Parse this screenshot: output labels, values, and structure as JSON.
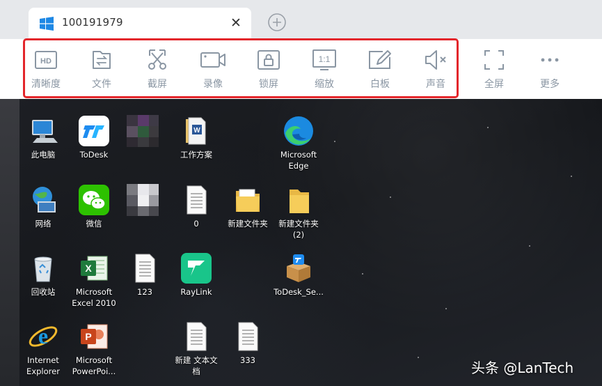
{
  "tab": {
    "title": "100191979",
    "close": "✕",
    "os_icon": "windows-logo-icon"
  },
  "toolbar": {
    "items": [
      {
        "label": "清晰度",
        "icon": "hd-icon"
      },
      {
        "label": "文件",
        "icon": "file-transfer-icon"
      },
      {
        "label": "截屏",
        "icon": "screenshot-icon"
      },
      {
        "label": "录像",
        "icon": "video-camera-icon"
      },
      {
        "label": "锁屏",
        "icon": "lock-screen-icon"
      },
      {
        "label": "缩放",
        "icon": "scale-icon"
      },
      {
        "label": "白板",
        "icon": "whiteboard-icon"
      },
      {
        "label": "声音",
        "icon": "sound-muted-icon"
      },
      {
        "label": "全屏",
        "icon": "fullscreen-icon"
      },
      {
        "label": "更多",
        "icon": "more-icon"
      }
    ],
    "hd_text": "HD",
    "scale_text": "1:1",
    "highlight_color": "#e3262b"
  },
  "desktop": {
    "icons": [
      {
        "label": "此电脑",
        "icon": "computer-icon"
      },
      {
        "label": "ToDesk",
        "icon": "todesk-icon"
      },
      {
        "label": "",
        "icon": "blurred-icon"
      },
      {
        "label": "工作方案",
        "icon": "word-doc-icon"
      },
      {
        "label": "Microsoft\nEdge",
        "icon": "edge-icon"
      },
      {
        "label": "网络",
        "icon": "network-icon"
      },
      {
        "label": "微信",
        "icon": "wechat-icon"
      },
      {
        "label": "",
        "icon": "blurred-icon"
      },
      {
        "label": "0",
        "icon": "text-file-icon"
      },
      {
        "label": "新建文件夹",
        "icon": "folder-icon"
      },
      {
        "label": "新建文件夹\n(2)",
        "icon": "folder-icon"
      },
      {
        "label": "回收站",
        "icon": "recycle-bin-icon"
      },
      {
        "label": "Microsoft\nExcel 2010",
        "icon": "excel-icon"
      },
      {
        "label": "123",
        "icon": "text-file-icon"
      },
      {
        "label": "RayLink",
        "icon": "raylink-icon"
      },
      {
        "label": "ToDesk_Se...",
        "icon": "package-icon"
      },
      {
        "label": "Internet\nExplorer",
        "icon": "ie-icon"
      },
      {
        "label": "Microsoft\nPowerPoi...",
        "icon": "powerpoint-icon"
      },
      {
        "label": "新建 文本文\n档",
        "icon": "text-file-icon"
      },
      {
        "label": "333",
        "icon": "text-file-icon"
      }
    ]
  },
  "watermark": "头条 @LanTech"
}
